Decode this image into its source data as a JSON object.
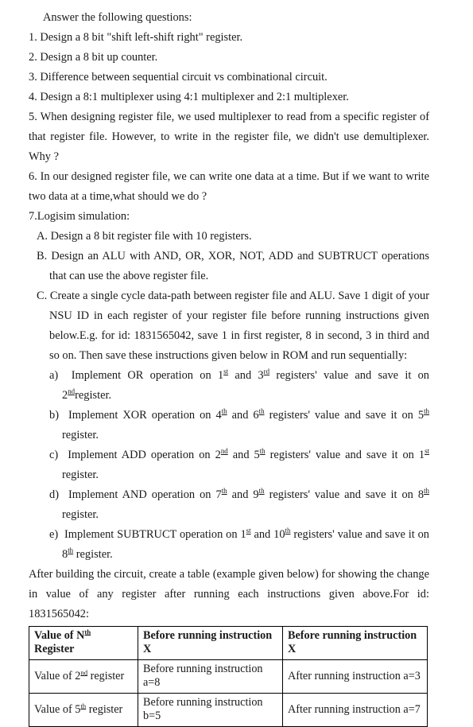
{
  "document": {
    "intro": "Answer the following questions:",
    "questions": [
      "1. Design a 8 bit \"shift left-shift right\" register.",
      "2. Design a 8 bit up counter.",
      "3. Difference between sequential circuit vs combinational circuit.",
      "4. Design a 8:1 multiplexer using 4:1 multiplexer and 2:1 multiplexer.",
      "5. When designing register file, we used multiplexer to read from a specific register of that register file. However, to write in the register file, we didn't use demultiplexer. Why ?",
      "6. In our designed register file, we can write one data at a time. But if we want to write two data at a time,what should we do ?",
      "7.Logisim simulation:"
    ],
    "sub_items": {
      "a_label": "A.",
      "a_text": "Design a 8 bit register file with 10 registers.",
      "b_label": "B.",
      "b_text": "Design an ALU with AND, OR, XOR, NOT, ADD and SUBTRUCT operations that can use the above register file.",
      "c_label": "C.",
      "c_text_1": "Create a single cycle data-path between register file and ALU. Save 1 digit of your NSU ID in each register of your register file before running instructions given below.E.g. for id: 1831565042, save 1 in first register, 8 in second, 3 in third and so on. Then save these instructions given below in ROM  and run sequentially:"
    },
    "instructions": [
      {
        "label": "a)",
        "pre": "Implement OR operation on 1",
        "sup1": "st",
        "mid": " and 3",
        "sup2": "rd",
        "post": " registers' value and save it on 2",
        "sup3": "nd",
        "tail": "register."
      },
      {
        "label": "b)",
        "pre": "Implement XOR operation on 4",
        "sup1": "th",
        "mid": " and 6",
        "sup2": "th",
        "post": " registers' value and save it on 5",
        "sup3": "th",
        "tail": " register."
      },
      {
        "label": "c)",
        "pre": "Implement ADD operation on 2",
        "sup1": "nd",
        "mid": "  and 5",
        "sup2": "th",
        "post": " registers' value and save it on 1",
        "sup3": "st",
        "tail": " register."
      },
      {
        "label": "d)",
        "pre": "Implement AND operation on 7",
        "sup1": "th",
        "mid": " and 9",
        "sup2": "th",
        "post": " registers' value and save it on 8",
        "sup3": "th",
        "tail": " register."
      },
      {
        "label": "e)",
        "pre": "Implement SUBTRUCT operation on 1",
        "sup1": "st",
        "mid": " and 10",
        "sup2": "th",
        "post": " registers' value and save it on 8",
        "sup3": "th",
        "tail": " register."
      }
    ],
    "closing_paragraph": "After building the circuit, create a table (example given below) for showing the change in value of any register after running each instructions given above.For id: 1831565042:",
    "table": {
      "header": {
        "col1_pre": "Value of N",
        "col1_sup": "th",
        "col1_post": " Register",
        "col2": "Before running instruction X",
        "col3": "Before running instruction X"
      },
      "rows": [
        {
          "c1_pre": "Value of 2",
          "c1_sup": "nd",
          "c1_post": " register",
          "c2": "Before running instruction a=8",
          "c3": "After running instruction a=3"
        },
        {
          "c1_pre": "Value of 5",
          "c1_sup": "th",
          "c1_post": " register",
          "c2": "Before running instruction b=5",
          "c3": "After running instruction a=7"
        }
      ]
    }
  }
}
